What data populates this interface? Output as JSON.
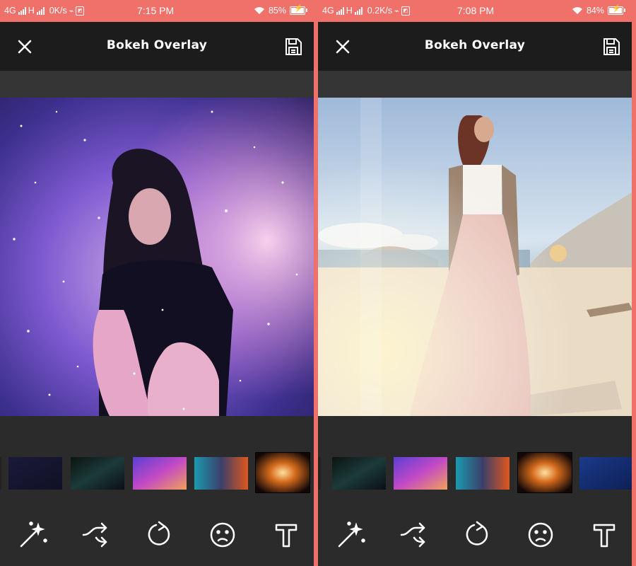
{
  "screens": [
    {
      "status": {
        "network": "4G",
        "network2": "H",
        "speed": "0K/s",
        "time": "7:15 PM",
        "battery": "85%"
      },
      "appbar": {
        "title": "Bokeh Overlay",
        "close_icon": "close-icon",
        "save_icon": "save-icon"
      },
      "photo": "woman in black top sitting under purple galaxy bokeh overlay",
      "thumbnails": [
        "partial",
        "dark-navy-starfield",
        "dark-green-nebula",
        "purple-pink-galaxy",
        "teal-orange-nebula",
        "orange-cloud-nebula"
      ],
      "toolbar": [
        "magic-wand-icon",
        "shuffle-icon",
        "rotate-icon",
        "sad-face-icon",
        "text-icon"
      ]
    },
    {
      "status": {
        "network": "4G",
        "network2": "H",
        "speed": "0.2K/s",
        "time": "7:08 PM",
        "battery": "84%"
      },
      "appbar": {
        "title": "Bokeh Overlay",
        "close_icon": "close-icon",
        "save_icon": "save-icon"
      },
      "photo": "woman in long pink skirt on beach with light leak overlay",
      "thumbnails": [
        "partial",
        "dark-green-nebula",
        "purple-pink-galaxy",
        "teal-orange-nebula",
        "orange-cloud-nebula",
        "blue-starfield"
      ],
      "toolbar": [
        "magic-wand-icon",
        "shuffle-icon",
        "rotate-icon",
        "sad-face-icon",
        "text-icon"
      ]
    }
  ],
  "colors": {
    "accent": "#f0706a",
    "appbar": "#1c1c1c",
    "background": "#2b2b2b"
  }
}
